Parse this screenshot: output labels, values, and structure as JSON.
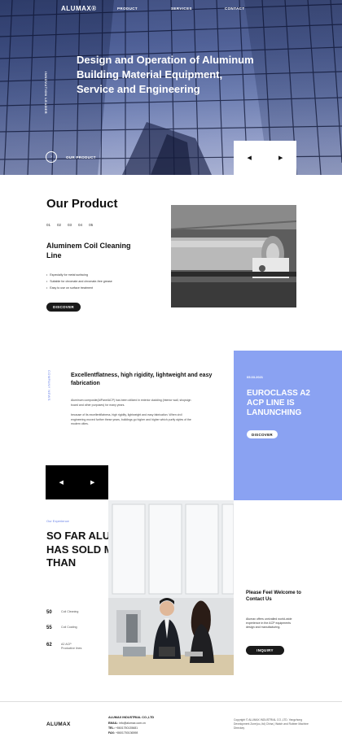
{
  "header": {
    "logo": "ALUMAX®",
    "nav": [
      "PRODUCT",
      "SERVICES",
      "CONTACT"
    ]
  },
  "hero": {
    "vertical_label": "INNOVATION LEADER",
    "title": "Design and Operation of Aluminum Building Material Equipment, Service and Engineering",
    "link_label": "OUR PRODUCT",
    "prev_icon": "arrow-left-icon",
    "next_icon": "arrow-right-icon"
  },
  "product": {
    "section_title": "Our Product",
    "pages": [
      "01",
      "02",
      "03",
      "04",
      "05"
    ],
    "name": "Aluminem Coil Cleaning Line",
    "bullets": [
      "Especially for metal surfacing",
      "Suitable for chromate and chromate-free grease",
      "Easy to use on surface treatment"
    ],
    "button": "DISCOVER"
  },
  "news": {
    "vertical_label": "COMPANY NEWS",
    "title": "Excellentflatness, high rigidity, lightweight and easy fabrication",
    "paragraph1": "Aluminum composite(AlPanelACP) has been utilized in exterior cladding (interior wall, shopsign board and other purposes) for many years.",
    "paragraph2": "because of its excellentflatness, high rigidity, lightweight and easy fabrication. When civil engineering moved further these years, buildings go higher and higher which purify styles of the modern cities.",
    "card_date": "05.03.2021",
    "card_title": "EUROCLASS A2 ACP LINE IS LANUNCHING",
    "card_button": "DISCOVER"
  },
  "experience": {
    "label": "Our Experience",
    "title": "SO FAR ALUMAX HAS SOLD MORE THAN",
    "stats": [
      {
        "num": "50",
        "label": "Coil Cleaning"
      },
      {
        "num": "55",
        "label": "Coil Coating"
      },
      {
        "num": "62",
        "label": "A2 ACP Productive lines"
      }
    ],
    "welcome_title": "Please Feel Welcome to Contact Us",
    "welcome_text": "Alumax offers unrivalled world-wide experience in the ACP equipments design and manufacturing.",
    "button": "INQUIRY"
  },
  "footer": {
    "logo": "ALUMAX",
    "company": "ALUMAX INDUSTRIAL CO.,LTD",
    "email_label": "EMAIL:",
    "email": "info@alumax.com.cn",
    "tel_label": "TEL:",
    "tel": "+8601750135681",
    "fax_label": "FAX:",
    "fax": "+8601750136598",
    "copyright": "Copyright © ALUMAX INDUSTRIAL CO.,LTD. Yangzhong Development Zone(co.,ltd) China | Watch and Rubber Machine Directory"
  }
}
